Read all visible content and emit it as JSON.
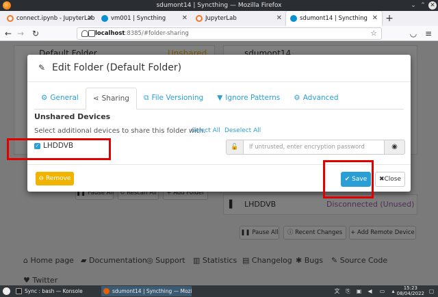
{
  "window": {
    "title": "sdumont14 | Syncthing — Mozilla Firefox"
  },
  "tabs": [
    {
      "label": "connect.ipynb - JupyterLab",
      "icon": "jupyter-icon",
      "color": "#f37726"
    },
    {
      "label": "vm001 | Syncthing",
      "icon": "syncthing-icon",
      "color": "#0891d1"
    },
    {
      "label": "JupyterLab",
      "icon": "jupyter-icon",
      "color": "#f37726"
    },
    {
      "label": "sdumont14 | Syncthing",
      "icon": "syncthing-icon",
      "color": "#0891d1"
    }
  ],
  "url": {
    "host": "localhost",
    "path": ":8385/#folder-sharing"
  },
  "background": {
    "folder_title": "Default Folder",
    "folder_status": "Unshared",
    "device_name": "sdumont14",
    "remote_device": "LHDDVB",
    "remote_status": "Disconnected (Unused)",
    "pause_all": "Pause All",
    "rescan_all": "Rescan All",
    "add_folder": "Add Folder",
    "recent_changes": "Recent Changes",
    "add_remote_device": "Add Remote Device"
  },
  "footer": {
    "links": [
      "Home page",
      "Documentation",
      "Support",
      "Statistics",
      "Changelog",
      "Bugs",
      "Source Code",
      "Twitter"
    ]
  },
  "modal": {
    "title": "Edit Folder (Default Folder)",
    "tabs": [
      "General",
      "Sharing",
      "File Versioning",
      "Ignore Patterns",
      "Advanced"
    ],
    "section_title": "Unshared Devices",
    "help_text": "Select additional devices to share this folder with.",
    "select_all": "Select All",
    "deselect_all": "Deselect All",
    "device_label": "LHDDVB",
    "device_checked": true,
    "encryption_placeholder": "If untrusted, enter encryption password",
    "remove_label": "Remove",
    "save_label": "Save",
    "close_label": "Close"
  },
  "taskbar": {
    "items": [
      "Sync : bash — Konsole",
      "sdumont14 | Syncthing — Mozill..."
    ],
    "time": "15:23",
    "date": "08/04/2022"
  },
  "colors": {
    "accent": "#2a9fd6",
    "warning": "#f0b400",
    "status_disconnected": "#9b5fa8",
    "annotation": "#e00000"
  }
}
